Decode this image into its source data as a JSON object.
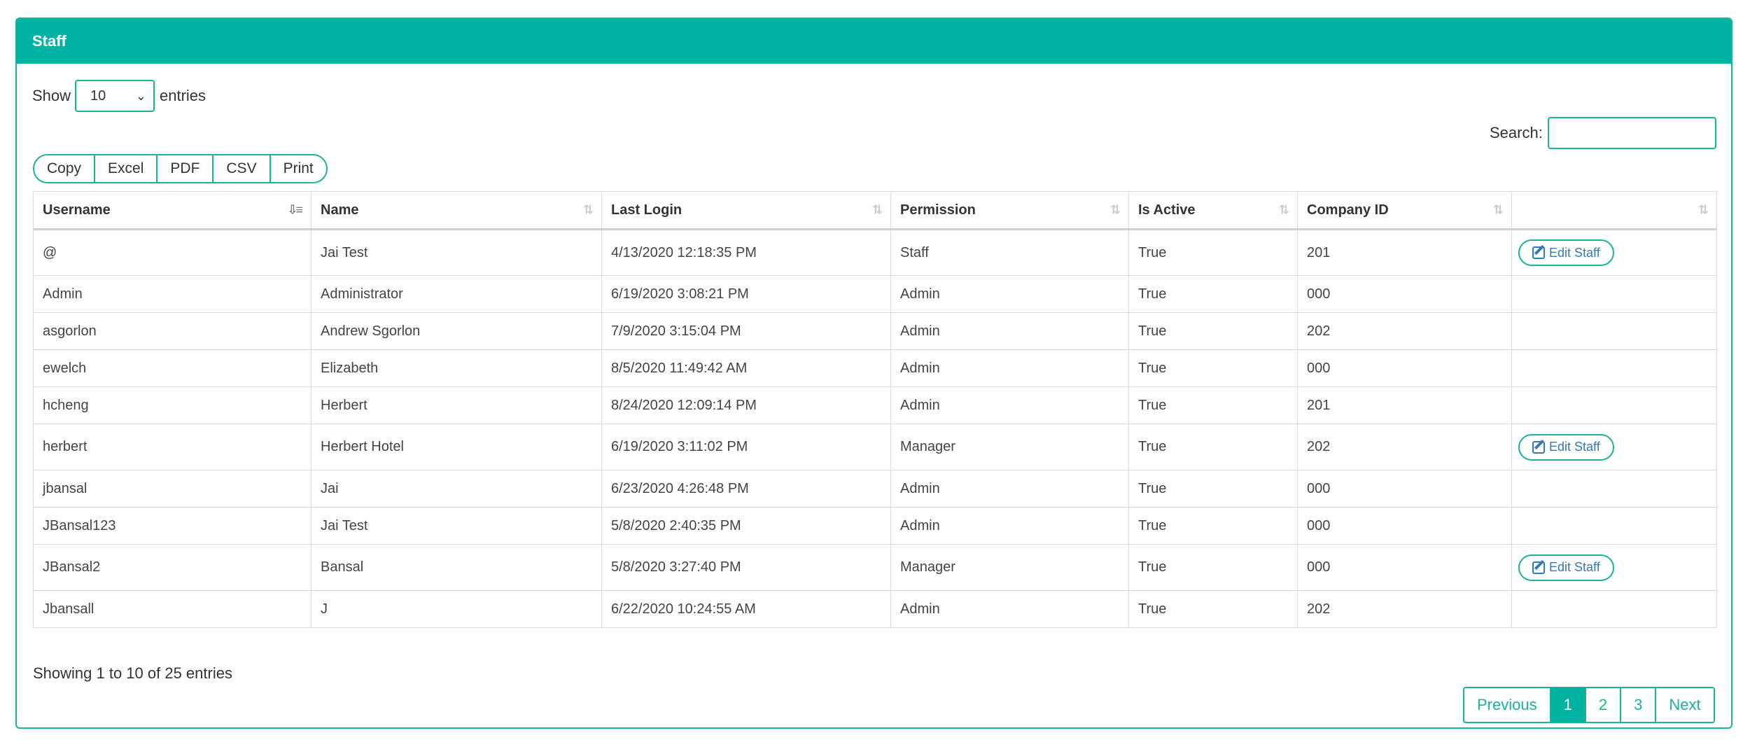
{
  "panel": {
    "title": "Staff"
  },
  "length": {
    "show_label": "Show",
    "value": "10",
    "entries_label": "entries"
  },
  "search": {
    "label": "Search:",
    "value": ""
  },
  "buttons": [
    "Copy",
    "Excel",
    "PDF",
    "CSV",
    "Print"
  ],
  "table": {
    "headers": [
      "Username",
      "Name",
      "Last Login",
      "Permission",
      "Is Active",
      "Company ID",
      ""
    ],
    "sorted_column": "Username",
    "rows": [
      {
        "username": "@",
        "name": "Jai Test",
        "last_login": "4/13/2020 12:18:35 PM",
        "permission": "Staff",
        "is_active": "True",
        "company_id": "201",
        "action": "Edit Staff"
      },
      {
        "username": "Admin",
        "name": "Administrator",
        "last_login": "6/19/2020 3:08:21 PM",
        "permission": "Admin",
        "is_active": "True",
        "company_id": "000",
        "action": ""
      },
      {
        "username": "asgorlon",
        "name": "Andrew Sgorlon",
        "last_login": "7/9/2020 3:15:04 PM",
        "permission": "Admin",
        "is_active": "True",
        "company_id": "202",
        "action": ""
      },
      {
        "username": "ewelch",
        "name": "Elizabeth",
        "last_login": "8/5/2020 11:49:42 AM",
        "permission": "Admin",
        "is_active": "True",
        "company_id": "000",
        "action": ""
      },
      {
        "username": "hcheng",
        "name": "Herbert",
        "last_login": "8/24/2020 12:09:14 PM",
        "permission": "Admin",
        "is_active": "True",
        "company_id": "201",
        "action": ""
      },
      {
        "username": "herbert",
        "name": "Herbert Hotel",
        "last_login": "6/19/2020 3:11:02 PM",
        "permission": "Manager",
        "is_active": "True",
        "company_id": "202",
        "action": "Edit Staff"
      },
      {
        "username": "jbansal",
        "name": "Jai",
        "last_login": "6/23/2020 4:26:48 PM",
        "permission": "Admin",
        "is_active": "True",
        "company_id": "000",
        "action": ""
      },
      {
        "username": "JBansal123",
        "name": "Jai Test",
        "last_login": "5/8/2020 2:40:35 PM",
        "permission": "Admin",
        "is_active": "True",
        "company_id": "000",
        "action": ""
      },
      {
        "username": "JBansal2",
        "name": "Bansal",
        "last_login": "5/8/2020 3:27:40 PM",
        "permission": "Manager",
        "is_active": "True",
        "company_id": "000",
        "action": "Edit Staff"
      },
      {
        "username": "Jbansall",
        "name": "J",
        "last_login": "6/22/2020 10:24:55 AM",
        "permission": "Admin",
        "is_active": "True",
        "company_id": "202",
        "action": ""
      }
    ]
  },
  "info": "Showing 1 to 10 of 25 entries",
  "pagination": {
    "previous": "Previous",
    "pages": [
      "1",
      "2",
      "3"
    ],
    "current": "1",
    "next": "Next"
  },
  "colors": {
    "accent": "#00b2a1",
    "border": "#1ab394",
    "link": "#337ab7"
  },
  "icons": {
    "sort": "sort-icon",
    "sort_active": "sort-alpha-down-icon",
    "edit": "edit-icon",
    "dropdown": "chevron-down-icon"
  }
}
